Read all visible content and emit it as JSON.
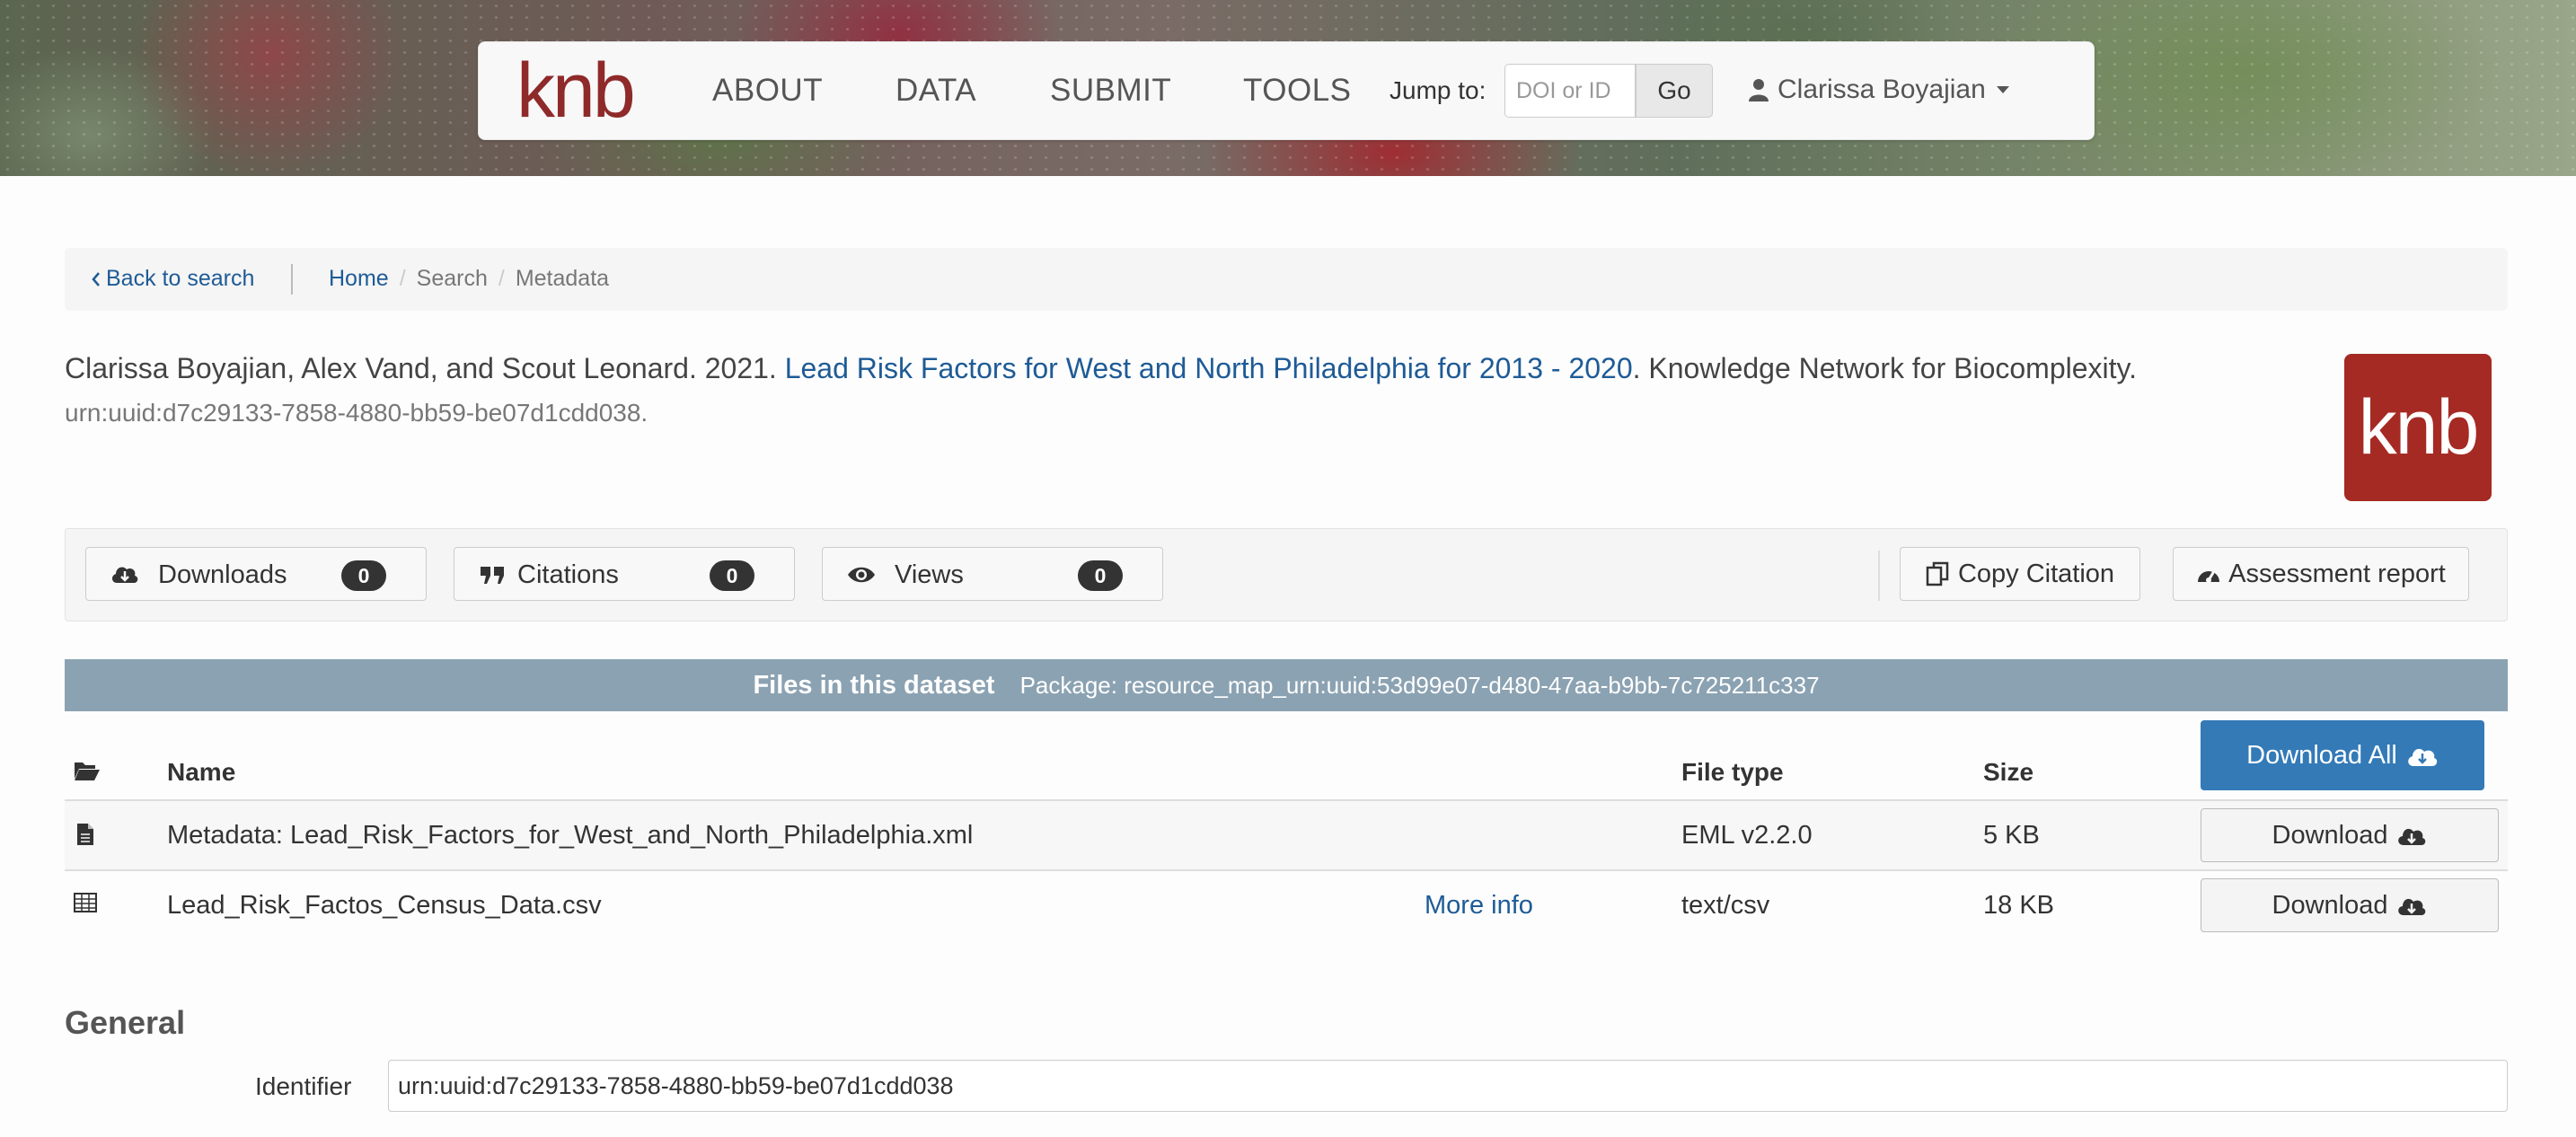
{
  "header": {
    "logo_text": "knb",
    "nav": [
      "ABOUT",
      "DATA",
      "SUBMIT",
      "TOOLS"
    ],
    "jump_label": "Jump to:",
    "jump_placeholder": "DOI or ID",
    "go_label": "Go",
    "user_name": "Clarissa Boyajian",
    "user_icon": "user-icon"
  },
  "breadcrumb": {
    "back": "Back to search",
    "home": "Home",
    "search": "Search",
    "metadata": "Metadata",
    "separator": "/"
  },
  "citation": {
    "authors": "Clarissa Boyajian, Alex Vand, and Scout Leonard. 2021. ",
    "title": "Lead Risk Factors for West and North Philadelphia for 2013 - 2020",
    "publisher": ". Knowledge Network for Biocomplexity.",
    "identifier": "urn:uuid:d7c29133-7858-4880-bb59-be07d1cdd038.",
    "logo_text": "knb"
  },
  "metrics": {
    "downloads": {
      "label": "Downloads",
      "count": "0",
      "icon": "cloud-download-icon"
    },
    "citations": {
      "label": "Citations",
      "count": "0",
      "icon": "quote-icon"
    },
    "views": {
      "label": "Views",
      "count": "0",
      "icon": "eye-icon"
    },
    "copy_citation": "Copy Citation",
    "assessment_report": "Assessment report"
  },
  "files": {
    "title": "Files in this dataset",
    "package": "Package: resource_map_urn:uuid:53d99e07-d480-47aa-b9bb-7c725211c337",
    "columns": {
      "name": "Name",
      "file_type": "File type",
      "size": "Size"
    },
    "download_all": "Download All",
    "rows": [
      {
        "name": "Metadata: Lead_Risk_Factors_for_West_and_North_Philadelphia.xml",
        "more_info": "",
        "file_type": "EML v2.2.0",
        "size": "5 KB",
        "download": "Download",
        "icon": "file-icon"
      },
      {
        "name": "Lead_Risk_Factos_Census_Data.csv",
        "more_info": "More info",
        "file_type": "text/csv",
        "size": "18 KB",
        "download": "Download",
        "icon": "table-icon"
      }
    ]
  },
  "general": {
    "title": "General",
    "identifier_label": "Identifier",
    "identifier_value": "urn:uuid:d7c29133-7858-4880-bb59-be07d1cdd038"
  },
  "colors": {
    "link": "#1e5b96",
    "brand": "#a52a24",
    "primary_button": "#337ab7",
    "files_header": "#8ba2b2"
  }
}
